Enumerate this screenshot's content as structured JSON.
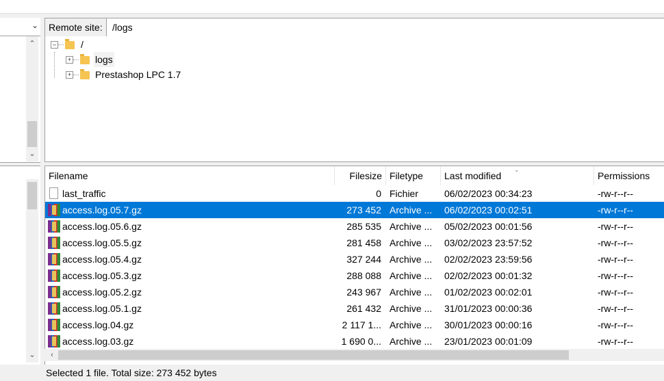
{
  "remote": {
    "label": "Remote site:",
    "path": "/logs"
  },
  "tree": {
    "root": "/",
    "nodes": [
      {
        "label": "logs",
        "selected": true
      },
      {
        "label": "Prestashop LPC 1.7",
        "selected": false
      }
    ]
  },
  "filelist": {
    "columns": {
      "filename": "Filename",
      "filesize": "Filesize",
      "filetype": "Filetype",
      "modified": "Last modified",
      "permissions": "Permissions"
    },
    "rows": [
      {
        "name": "last_traffic",
        "size": "0",
        "type": "Fichier",
        "modified": "06/02/2023 00:34:23",
        "perms": "-rw-r--r--",
        "icon": "file-icon",
        "selected": false
      },
      {
        "name": "access.log.05.7.gz",
        "size": "273 452",
        "type": "Archive ...",
        "modified": "06/02/2023 00:02:51",
        "perms": "-rw-r--r--",
        "icon": "archive-icon",
        "selected": true
      },
      {
        "name": "access.log.05.6.gz",
        "size": "285 535",
        "type": "Archive ...",
        "modified": "05/02/2023 00:01:56",
        "perms": "-rw-r--r--",
        "icon": "archive-icon",
        "selected": false
      },
      {
        "name": "access.log.05.5.gz",
        "size": "281 458",
        "type": "Archive ...",
        "modified": "03/02/2023 23:57:52",
        "perms": "-rw-r--r--",
        "icon": "archive-icon",
        "selected": false
      },
      {
        "name": "access.log.05.4.gz",
        "size": "327 244",
        "type": "Archive ...",
        "modified": "02/02/2023 23:59:56",
        "perms": "-rw-r--r--",
        "icon": "archive-icon",
        "selected": false
      },
      {
        "name": "access.log.05.3.gz",
        "size": "288 088",
        "type": "Archive ...",
        "modified": "02/02/2023 00:01:32",
        "perms": "-rw-r--r--",
        "icon": "archive-icon",
        "selected": false
      },
      {
        "name": "access.log.05.2.gz",
        "size": "243 967",
        "type": "Archive ...",
        "modified": "01/02/2023 00:02:01",
        "perms": "-rw-r--r--",
        "icon": "archive-icon",
        "selected": false
      },
      {
        "name": "access.log.05.1.gz",
        "size": "261 432",
        "type": "Archive ...",
        "modified": "31/01/2023 00:00:36",
        "perms": "-rw-r--r--",
        "icon": "archive-icon",
        "selected": false
      },
      {
        "name": "access.log.04.gz",
        "size": "2 117 1...",
        "type": "Archive ...",
        "modified": "30/01/2023 00:00:16",
        "perms": "-rw-r--r--",
        "icon": "archive-icon",
        "selected": false
      },
      {
        "name": "access.log.03.gz",
        "size": "1 690 0...",
        "type": "Archive ...",
        "modified": "23/01/2023 00:01:09",
        "perms": "-rw-r--r--",
        "icon": "archive-icon",
        "selected": false
      }
    ]
  },
  "status": {
    "text": "Selected 1 file. Total size: 273 452 bytes"
  },
  "colors": {
    "selection": "#0078d7",
    "folder": "#f5c451"
  }
}
